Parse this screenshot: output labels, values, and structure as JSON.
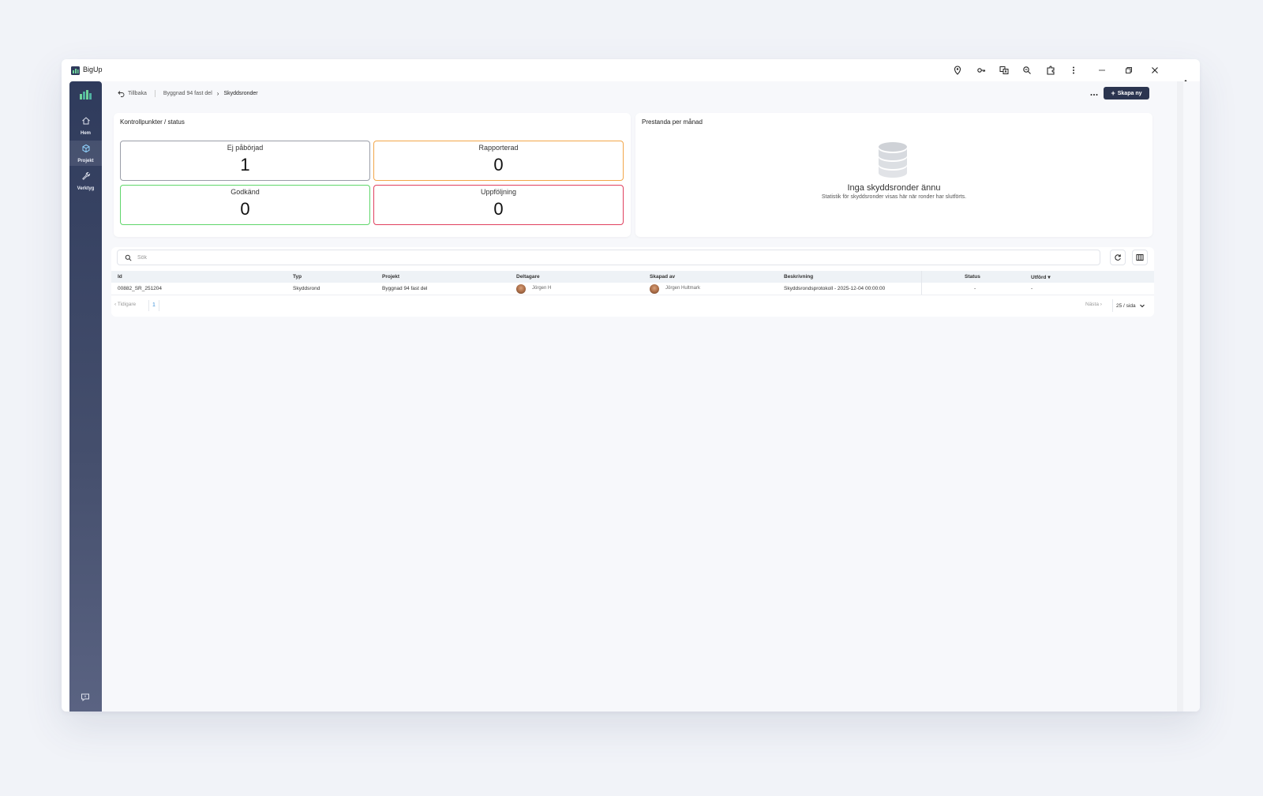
{
  "app": {
    "title": "BigUp"
  },
  "sidebar": {
    "items": [
      {
        "label": "Hem",
        "icon": "home-icon"
      },
      {
        "label": "Projekt",
        "icon": "cube-icon"
      },
      {
        "label": "Verktyg",
        "icon": "wrench-icon"
      }
    ],
    "active": "Projekt"
  },
  "breadcrumb": {
    "back": "Tillbaka",
    "parent": "Byggnad 94 fast del",
    "current": "Skyddsronder"
  },
  "toolbar": {
    "create_label": "Skapa ny"
  },
  "status_card": {
    "title": "Kontrollpunkter / status",
    "tiles": [
      {
        "label": "Ej påbörjad",
        "value": "1",
        "color": "#9a9ea8"
      },
      {
        "label": "Rapporterad",
        "value": "0",
        "color": "#f2a64a"
      },
      {
        "label": "Godkänd",
        "value": "0",
        "color": "#5fd66a"
      },
      {
        "label": "Uppföljning",
        "value": "0",
        "color": "#e0405e"
      }
    ]
  },
  "performance_card": {
    "title": "Prestanda per månad",
    "empty_title": "Inga skyddsronder ännu",
    "empty_subtitle": "Statistik för skyddsronder visas här när ronder har slutförts."
  },
  "search": {
    "placeholder": "Sök"
  },
  "table": {
    "columns": [
      "Id",
      "Typ",
      "Projekt",
      "Deltagare",
      "Skapad av",
      "Beskrivning",
      "Status",
      "Utförd"
    ],
    "rows": [
      {
        "id": "00882_SR_251204",
        "typ": "Skyddsrond",
        "projekt": "Byggnad 94 fast del",
        "deltagare": "Jörgen H",
        "skapad_av": "Jörgen Hultmark",
        "beskrivning": "Skyddsrondsprotokoll - 2025-12-04 00:00:00",
        "status": "-",
        "utford": "-"
      }
    ]
  },
  "pagination": {
    "prev": "Tidigare",
    "page": "1",
    "next": "Nästa",
    "page_size": "25 / sida"
  },
  "colors": {
    "accent": "#2b3550",
    "sidebar": "#2f3b5c",
    "link": "#3a8fd8"
  }
}
